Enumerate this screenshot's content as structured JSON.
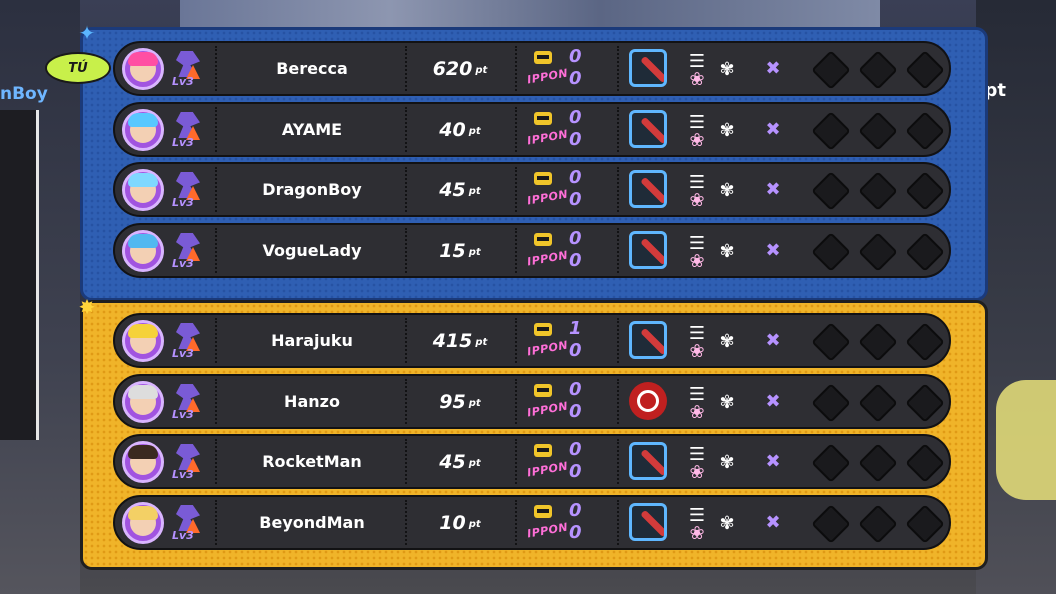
{
  "background": {
    "partial_name": "nBoy",
    "partial_pt": "pt"
  },
  "you_badge": "TÚ",
  "point_unit": "pt",
  "ippon_label": "IPPON",
  "level_label": "Lv3",
  "colors": {
    "blue_team": "#2f5fb3",
    "yellow_team": "#f0b429",
    "row_bg": "#2e2e33",
    "avatar_ring": "#a154e0",
    "accent_purple": "#b692ff",
    "ippon_pink": "#ff6fd8"
  },
  "teams": [
    {
      "name": "blue",
      "emblem_icon": "dragon-icon",
      "players": [
        {
          "name": "Berecca",
          "points": "620",
          "score_top": "0",
          "score_bottom": "0",
          "weapon": "bat",
          "hair": "#ff4fa3"
        },
        {
          "name": "AYAME",
          "points": "40",
          "score_top": "0",
          "score_bottom": "0",
          "weapon": "bat",
          "hair": "#58c8ff"
        },
        {
          "name": "DragonBoy",
          "points": "45",
          "score_top": "0",
          "score_bottom": "0",
          "weapon": "bat",
          "hair": "#7fd8ff"
        },
        {
          "name": "VogueLady",
          "points": "15",
          "score_top": "0",
          "score_bottom": "0",
          "weapon": "bat",
          "hair": "#52b8f0"
        }
      ]
    },
    {
      "name": "yellow",
      "emblem_icon": "lion-icon",
      "players": [
        {
          "name": "Harajuku",
          "points": "415",
          "score_top": "1",
          "score_bottom": "0",
          "weapon": "bat",
          "hair": "#f5d23a"
        },
        {
          "name": "Hanzo",
          "points": "95",
          "score_top": "0",
          "score_bottom": "0",
          "weapon": "yoyo",
          "hair": "#dddddd"
        },
        {
          "name": "RocketMan",
          "points": "45",
          "score_top": "0",
          "score_bottom": "0",
          "weapon": "bat",
          "hair": "#3b2a20"
        },
        {
          "name": "BeyondMan",
          "points": "10",
          "score_top": "0",
          "score_bottom": "0",
          "weapon": "bat",
          "hair": "#f3d065"
        }
      ]
    }
  ]
}
